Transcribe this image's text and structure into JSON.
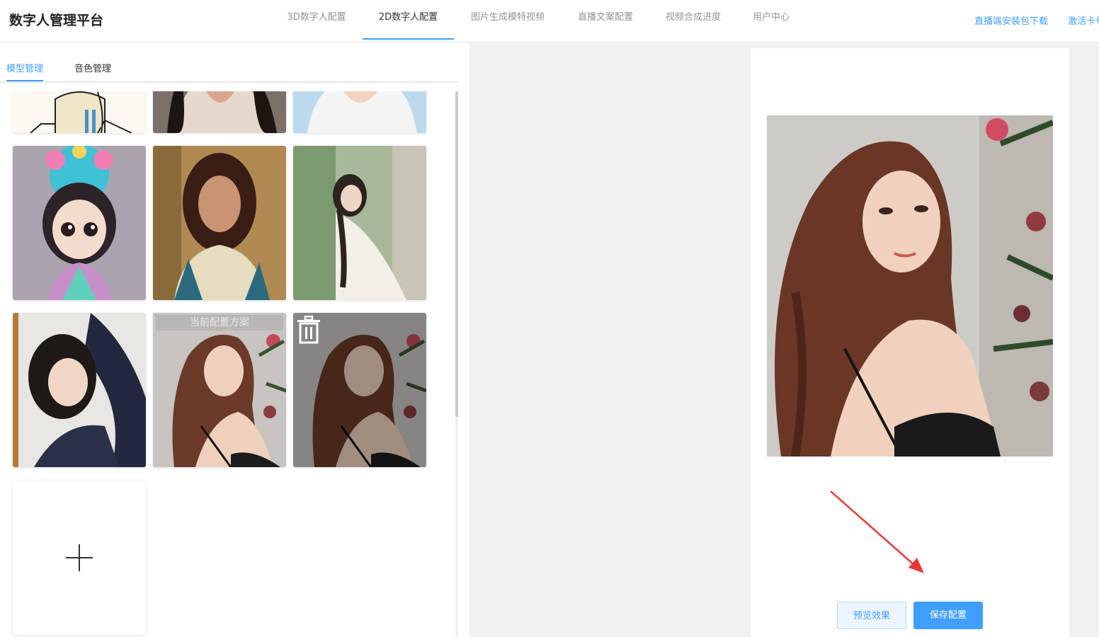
{
  "app": {
    "title": "数字人管理平台"
  },
  "nav": {
    "items": [
      {
        "label": "3D数字人配置",
        "active": false
      },
      {
        "label": "2D数字人配置",
        "active": true
      },
      {
        "label": "图片生成模特视频",
        "active": false
      },
      {
        "label": "直播文案配置",
        "active": false
      },
      {
        "label": "视频合成进度",
        "active": false
      },
      {
        "label": "用户中心",
        "active": false
      }
    ],
    "links": [
      {
        "label": "直播端安装包下载"
      },
      {
        "label": "激活卡号"
      }
    ]
  },
  "left": {
    "tabs": [
      {
        "label": "模型管理",
        "active": true
      },
      {
        "label": "音色管理",
        "active": false
      }
    ],
    "cards": [
      {
        "id": "card-1",
        "type": "cartoon-girl"
      },
      {
        "id": "card-2",
        "type": "woman-dark-hair"
      },
      {
        "id": "card-3",
        "type": "woman-white-top"
      },
      {
        "id": "card-4",
        "type": "chibi-girl-headdress"
      },
      {
        "id": "card-5",
        "type": "painted-woman"
      },
      {
        "id": "card-6",
        "type": "woman-outdoor-white-dress"
      },
      {
        "id": "card-7",
        "type": "woman-lying"
      },
      {
        "id": "card-8",
        "type": "woman-wavy-hair",
        "selected": true,
        "overlay": "当前配置方案"
      },
      {
        "id": "card-9",
        "type": "woman-wavy-hair",
        "hover": true
      }
    ],
    "current_label": "当前配置方案"
  },
  "preview": {
    "buttons": {
      "preview_label": "预览效果",
      "save_label": "保存配置"
    }
  },
  "colors": {
    "accent": "#409eff",
    "arrow": "#e53935"
  }
}
